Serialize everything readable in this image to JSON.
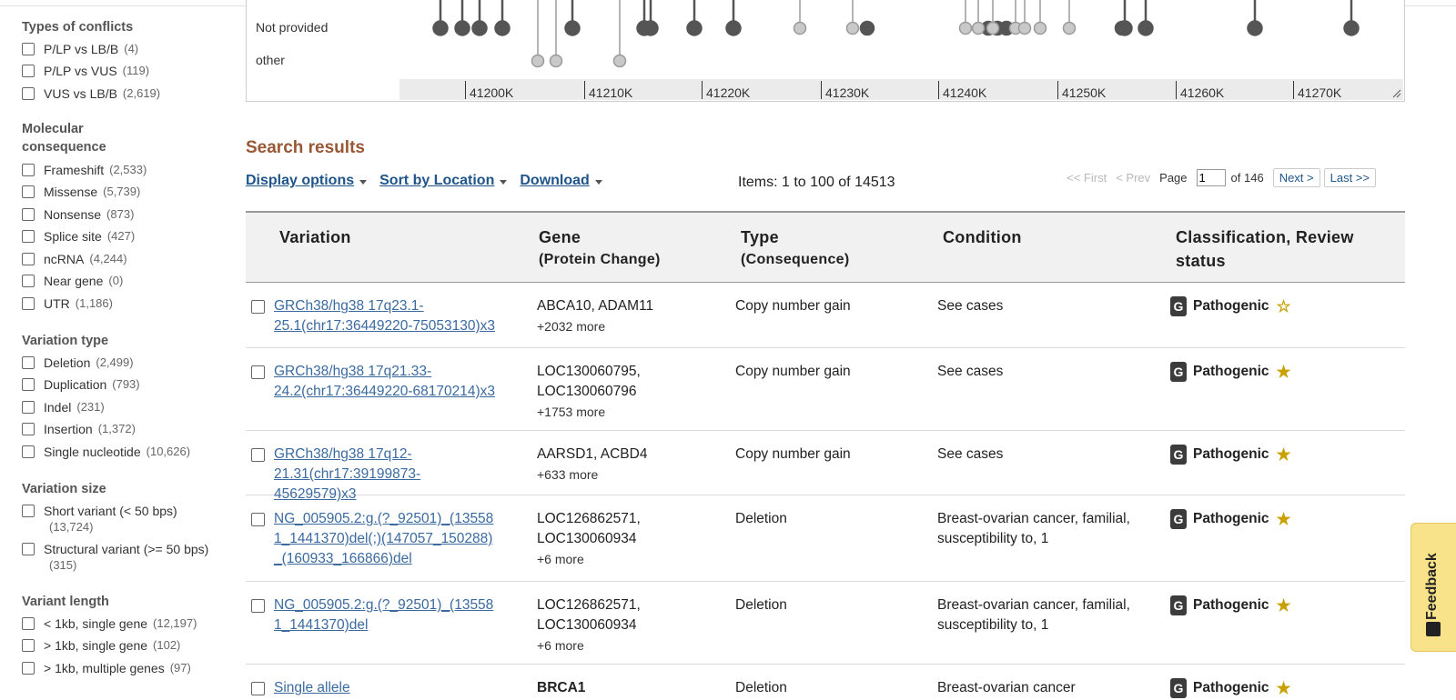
{
  "sidebar": {
    "groups": [
      {
        "title": "Types of conflicts",
        "items": [
          {
            "label": "P/LP vs LB/B",
            "count": "(4)"
          },
          {
            "label": "P/LP vs VUS",
            "count": "(119)"
          },
          {
            "label": "VUS vs LB/B",
            "count": "(2,619)"
          }
        ]
      },
      {
        "title": "Molecular consequence",
        "items": [
          {
            "label": "Frameshift",
            "count": "(2,533)"
          },
          {
            "label": "Missense",
            "count": "(5,739)"
          },
          {
            "label": "Nonsense",
            "count": "(873)"
          },
          {
            "label": "Splice site",
            "count": "(427)"
          },
          {
            "label": "ncRNA",
            "count": "(4,244)"
          },
          {
            "label": "Near gene",
            "count": "(0)"
          },
          {
            "label": "UTR",
            "count": "(1,186)"
          }
        ]
      },
      {
        "title": "Variation type",
        "items": [
          {
            "label": "Deletion",
            "count": "(2,499)"
          },
          {
            "label": "Duplication",
            "count": "(793)"
          },
          {
            "label": "Indel",
            "count": "(231)"
          },
          {
            "label": "Insertion",
            "count": "(1,372)"
          },
          {
            "label": "Single nucleotide",
            "count": "(10,626)"
          }
        ]
      },
      {
        "title": "Variation size",
        "items": [
          {
            "label": "Short variant (< 50 bps)",
            "count": "(13,724)"
          },
          {
            "label": "Structural variant (>= 50 bps)",
            "count": "(315)"
          }
        ]
      },
      {
        "title": "Variant length",
        "items": [
          {
            "label": "< 1kb, single gene",
            "count": "(12,197)"
          },
          {
            "label": "> 1kb, single gene",
            "count": "(102)"
          },
          {
            "label": "> 1kb, multiple genes",
            "count": "(97)"
          }
        ]
      }
    ]
  },
  "viewer": {
    "track_labels": [
      "Not provided",
      "other"
    ],
    "ruler_ticks": [
      "41200K",
      "41210K",
      "41220K",
      "41230K",
      "41240K",
      "41250K",
      "41260K",
      "41270K"
    ]
  },
  "results": {
    "title": "Search results",
    "display_options": "Display options",
    "sort_by": "Sort by Location",
    "download": "Download",
    "items_text": "Items: 1 to 100 of 14513",
    "pager": {
      "first": "<< First",
      "prev": "< Prev",
      "page_label": "Page",
      "page_value": "1",
      "of_pages": "of 146",
      "next": "Next >",
      "last": "Last >>"
    }
  },
  "table": {
    "headers": {
      "variation": "Variation",
      "gene": "Gene",
      "gene_sub": "(Protein Change)",
      "type": "Type",
      "type_sub": "(Consequence)",
      "condition": "Condition",
      "classification": "Classification, Review status"
    },
    "rows": [
      {
        "variation": "GRCh38/hg38 17q23.1-25.1(chr17:36449220-75053130)x3",
        "gene": "ABCA10, ADAM11",
        "more": "+2032 more",
        "type": "Copy number gain",
        "condition": "See cases",
        "badge": "G",
        "classification": "Pathogenic",
        "star": "☆"
      },
      {
        "variation": "GRCh38/hg38 17q21.33-24.2(chr17:36449220-68170214)x3",
        "gene": "LOC130060795, LOC130060796",
        "more": "+1753 more",
        "type": "Copy number gain",
        "condition": "See cases",
        "badge": "G",
        "classification": "Pathogenic",
        "star": "★"
      },
      {
        "variation": "GRCh38/hg38 17q12-21.31(chr17:39199873-45629579)x3",
        "gene": "AARSD1, ACBD4",
        "more": "+633 more",
        "type": "Copy number gain",
        "condition": "See cases",
        "badge": "G",
        "classification": "Pathogenic",
        "star": "★"
      },
      {
        "variation": "NG_005905.2:g.(?_92501)_(135581_1441370)del(;)(147057_150288)_(160933_166866)del",
        "gene": "LOC126862571, LOC130060934",
        "more": "+6 more",
        "type": "Deletion",
        "condition": "Breast-ovarian cancer, familial, susceptibility to, 1",
        "badge": "G",
        "classification": "Pathogenic",
        "star": "★"
      },
      {
        "variation": "NG_005905.2:g.(?_92501)_(135581_1441370)del",
        "gene": "LOC126862571, LOC130060934",
        "more": "+6 more",
        "type": "Deletion",
        "condition": "Breast-ovarian cancer, familial, susceptibility to, 1",
        "badge": "G",
        "classification": "Pathogenic",
        "star": "★"
      },
      {
        "variation": "Single allele",
        "gene": "BRCA1",
        "more": "",
        "type": "Deletion",
        "condition": "Breast-ovarian cancer",
        "badge": "G",
        "classification": "Pathogenic",
        "star": "★"
      }
    ]
  },
  "feedback": {
    "label": "Feedback"
  },
  "colors": {
    "link": "#3b6aa0",
    "results_title": "#985735",
    "star": "#c9a000",
    "feedback_bg": "#f8e38a"
  }
}
